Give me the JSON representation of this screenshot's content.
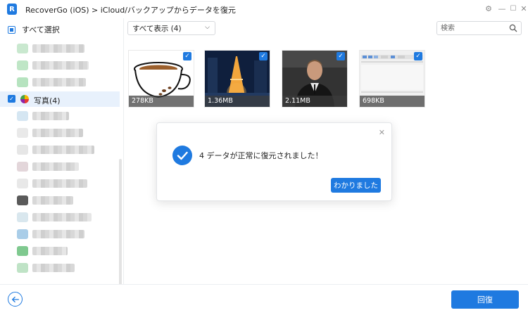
{
  "app": {
    "title": "RecoverGo (iOS) > iCloud/バックアップからデータを復元",
    "logo_letter": "R",
    "accent_color": "#1f7ae0"
  },
  "window_controls": [
    {
      "name": "settings-icon",
      "glyph": "⚙"
    },
    {
      "name": "minimize-icon",
      "glyph": "—"
    },
    {
      "name": "maximize-icon",
      "glyph": "☐"
    },
    {
      "name": "close-icon",
      "glyph": "✕"
    }
  ],
  "sidebar": {
    "select_all_label": "すべて選択",
    "active_item": {
      "label": "写真(4)",
      "checked": true
    }
  },
  "toolbar": {
    "filter_selected": "すべて表示 (4)",
    "search_placeholder": "検索"
  },
  "thumbnails": [
    {
      "size": "278KB",
      "checked": true,
      "subject": "coffee-cup"
    },
    {
      "size": "1.36MB",
      "checked": true,
      "subject": "night-tower"
    },
    {
      "size": "2.11MB",
      "checked": true,
      "subject": "portrait"
    },
    {
      "size": "698KB",
      "checked": true,
      "subject": "screenshot"
    }
  ],
  "dialog": {
    "message": "4 データが正常に復元されました！",
    "ok_label": "わかりました"
  },
  "footer": {
    "recover_label": "回復"
  }
}
